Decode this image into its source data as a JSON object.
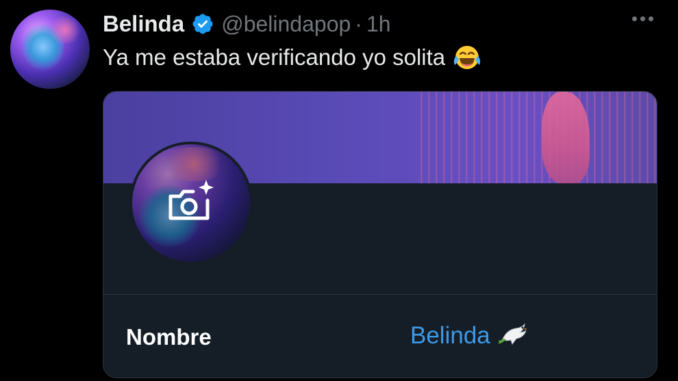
{
  "tweet": {
    "display_name": "Belinda",
    "handle": "@belindapop",
    "separator": "·",
    "time": "1h",
    "text": "Ya me estaba verificando yo solita",
    "icons": {
      "verified": "verified-badge-icon",
      "more": "more-options-icon",
      "emoji": "face-with-tears-of-joy-emoji"
    }
  },
  "card": {
    "field_label": "Nombre",
    "field_value": "Belinda",
    "icons": {
      "camera": "add-photo-camera-icon",
      "dove": "dove-emoji"
    }
  },
  "colors": {
    "background": "#000000",
    "text_primary": "#e7e9ea",
    "text_secondary": "#71767b",
    "verified_blue": "#1d9bf0",
    "link_blue": "#3a9ae8",
    "card_bg": "#151d27"
  }
}
